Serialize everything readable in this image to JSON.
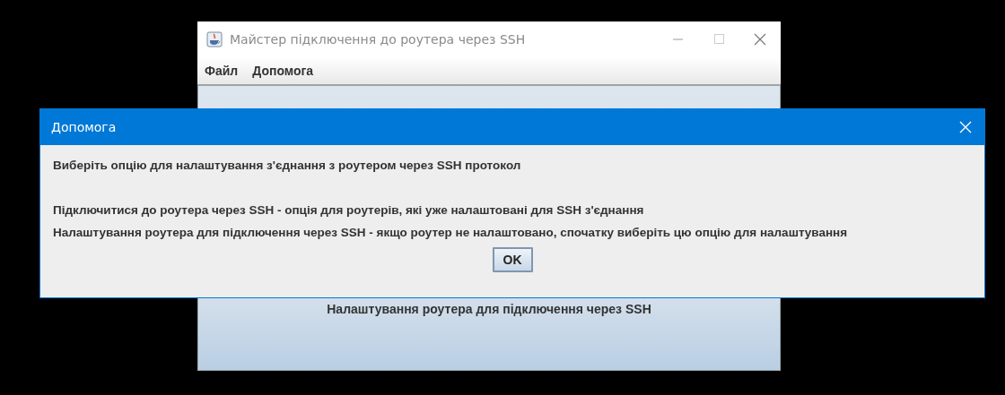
{
  "main_window": {
    "title": "Майстер підключення до роутера через SSH",
    "menu": [
      "Файл",
      "Допомога"
    ],
    "option_button": "Налаштування роутера для підключення через SSH"
  },
  "dialog": {
    "title": "Допомога",
    "intro": "Виберіть опцію для налаштування з'єднання з роутером через SSH протокол",
    "lines": [
      "Підключитися до роутера через SSH - опція для роутерів, які уже налаштовані для SSH з'єднання",
      "Налаштування роутера для підключення через SSH - якщо роутер не налаштовано, спочатку виберіть цю опцію для налаштування"
    ],
    "button": "OK"
  }
}
